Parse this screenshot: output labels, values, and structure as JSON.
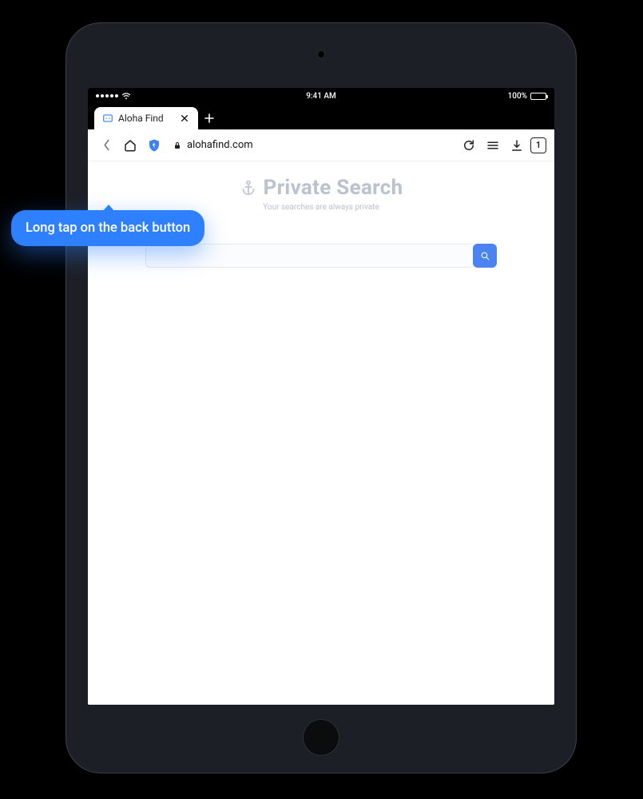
{
  "statusbar": {
    "time": "9:41 AM",
    "battery": "100%"
  },
  "tab": {
    "title": "Aloha Find"
  },
  "toolbar": {
    "url": "alohafind.com",
    "tabs_count": "1"
  },
  "hero": {
    "title": "Private Search",
    "subtitle": "Your searches are always private"
  },
  "tooltip": {
    "text": "Long tap on the back button"
  }
}
